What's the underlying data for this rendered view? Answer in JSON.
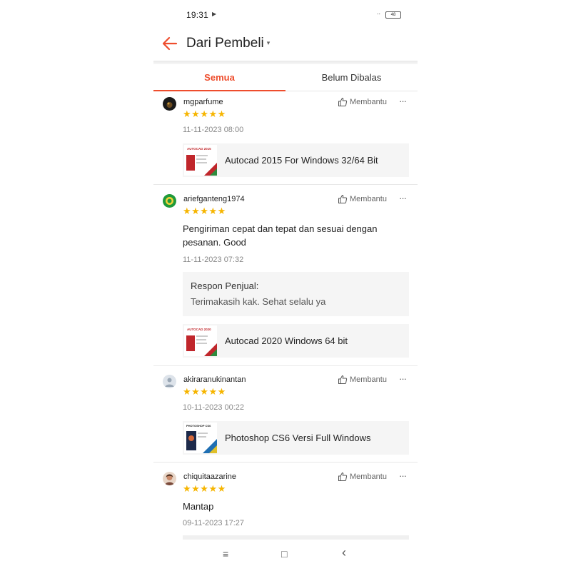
{
  "status_bar": {
    "time": "19:31",
    "play_icon": "▶",
    "signal": "..",
    "battery": "48"
  },
  "header": {
    "back_icon": "arrow-left-icon",
    "title": "Dari Pembeli",
    "caret": "▾",
    "accent_color": "#ee4d2d"
  },
  "tabs": [
    {
      "label": "Semua",
      "active": true
    },
    {
      "label": "Belum Dibalas",
      "active": false
    }
  ],
  "reviews": [
    {
      "username": "mgparfume",
      "rating": 5,
      "stars": "★★★★★",
      "helpful_label": "Membantu",
      "more": "···",
      "date": "11-11-2023 08:00",
      "product": {
        "name": "Autocad 2015 For Windows 32/64 Bit",
        "thumb_title": "AUTOCAD 2015"
      }
    },
    {
      "username": "ariefganteng1974",
      "rating": 5,
      "stars": "★★★★★",
      "helpful_label": "Membantu",
      "more": "···",
      "comment_line1": "Pengiriman cepat dan tepat dan sesuai dengan",
      "comment_line2": "pesanan. Good",
      "date": "11-11-2023 07:32",
      "seller_response": {
        "label": "Respon Penjual:",
        "text": "Terimakasih kak. Sehat selalu ya"
      },
      "product": {
        "name": "Autocad 2020 Windows 64 bit",
        "thumb_title": "AUTOCAD 2020"
      }
    },
    {
      "username": "akiraranukinantan",
      "rating": 5,
      "stars": "★★★★★",
      "helpful_label": "Membantu",
      "more": "···",
      "date": "10-11-2023 00:22",
      "product": {
        "name": "Photoshop CS6 Versi Full Windows",
        "thumb_title": "PHOTOSHOP CS6"
      }
    },
    {
      "username": "chiquitaazarine",
      "rating": 5,
      "stars": "★★★★★",
      "helpful_label": "Membantu",
      "more": "···",
      "comment": "Mantap",
      "date": "09-11-2023 17:27"
    }
  ],
  "nav_bar": {
    "menu": "≡",
    "home": "□",
    "back": "‹"
  }
}
